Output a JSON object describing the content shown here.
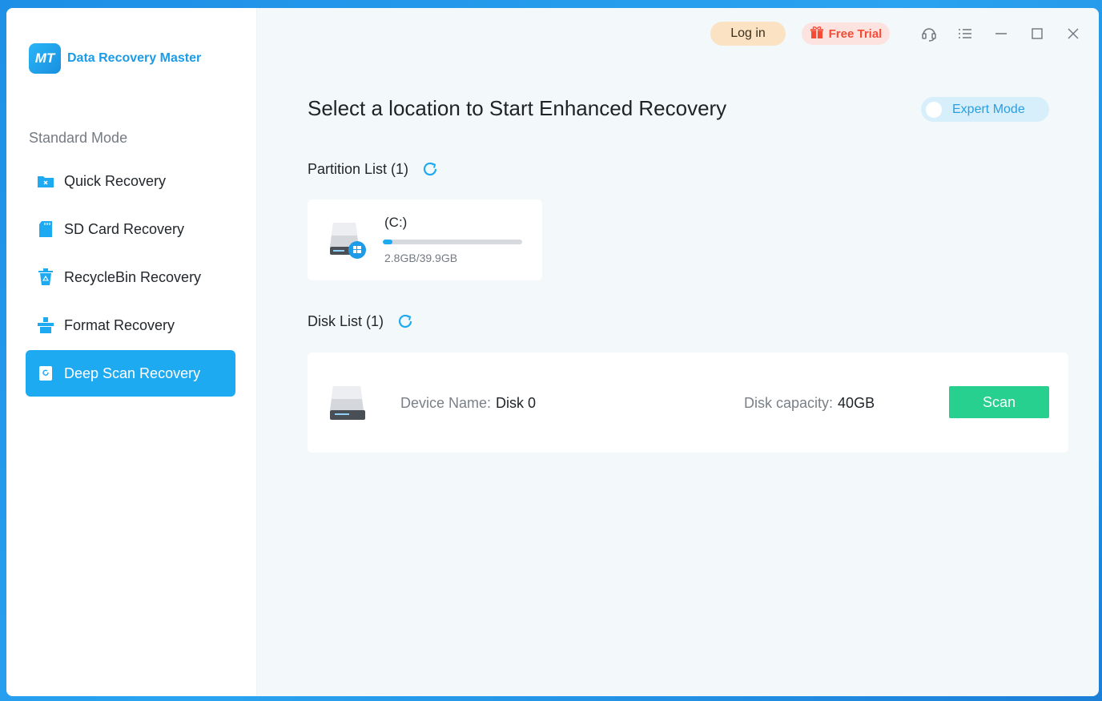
{
  "app": {
    "name": "Data Recovery Master",
    "logo_glyph": "MT"
  },
  "sidebar": {
    "mode_label": "Standard Mode",
    "items": [
      {
        "label": "Quick Recovery",
        "icon": "folder-icon",
        "active": false
      },
      {
        "label": "SD Card Recovery",
        "icon": "sd-card-icon",
        "active": false
      },
      {
        "label": "RecycleBin Recovery",
        "icon": "recycle-bin-icon",
        "active": false
      },
      {
        "label": "Format Recovery",
        "icon": "format-icon",
        "active": false
      },
      {
        "label": "Deep Scan Recovery",
        "icon": "deep-scan-icon",
        "active": true
      }
    ]
  },
  "topbar": {
    "login_label": "Log in",
    "trial_label": "Free Trial"
  },
  "main": {
    "title": "Select a location to Start Enhanced Recovery",
    "expert_mode_label": "Expert Mode",
    "partition_list_label": "Partition List (1)",
    "disk_list_label": "Disk List (1)"
  },
  "partitions": [
    {
      "name": "(C:)",
      "size_text": "2.8GB/39.9GB",
      "used_fraction": 0.07
    }
  ],
  "disks": [
    {
      "device_name_label": "Device Name:",
      "device_name": "Disk 0",
      "capacity_label": "Disk capacity:",
      "capacity": "40GB",
      "scan_label": "Scan"
    }
  ],
  "colors": {
    "accent": "#1eaaf1",
    "scan_button": "#27d08e",
    "login_bg": "#fbe2c3",
    "trial_text": "#f24b36"
  }
}
